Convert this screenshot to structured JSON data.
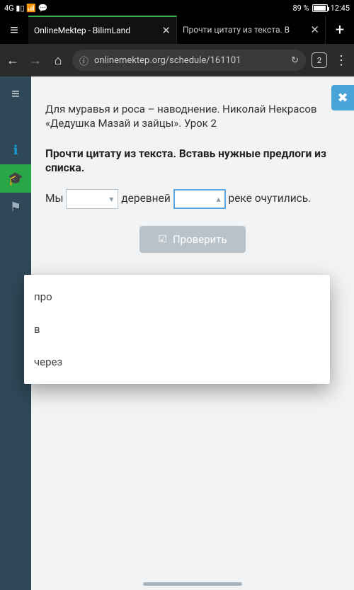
{
  "statusbar": {
    "network_icons": "4G ▮▯ 📶 💬",
    "battery_pct": "89 %",
    "time": "12:45"
  },
  "tabs": {
    "items": [
      {
        "label": "OnlineMektep - BilimLand"
      },
      {
        "label": "Прочти цитату из текста. В"
      }
    ],
    "close_glyph": "✕",
    "new_glyph": "+"
  },
  "urlbar": {
    "info_glyph": "ⓘ",
    "url": "onlinemektep.org/schedule/161101",
    "reload_glyph": "↻",
    "tabcount": "2",
    "menu_glyph": "⋮",
    "back_glyph": "←",
    "fwd_glyph": "→",
    "home_glyph": "⌂"
  },
  "rail": {
    "menu_glyph": "≡",
    "info_glyph": "ℹ",
    "grad_glyph": "🎓",
    "flag_glyph": "⚑"
  },
  "lesson": {
    "close_glyph": "✖",
    "title": "Для муравья и роса – наводнение. Николай Некрасов «Дедушка Мазай и зайцы». Урок 2",
    "instruction": "Прочти цитату из текста. Вставь нужные предлоги из списка.",
    "sentence": {
      "w1": "Мы",
      "w2": "деревней",
      "w3": "реке очутились."
    },
    "check_label": "Проверить",
    "check_tick": "☑",
    "dd_down": "▾",
    "dd_up": "▴"
  },
  "dropdown": {
    "options": [
      "про",
      "в",
      "через"
    ]
  }
}
